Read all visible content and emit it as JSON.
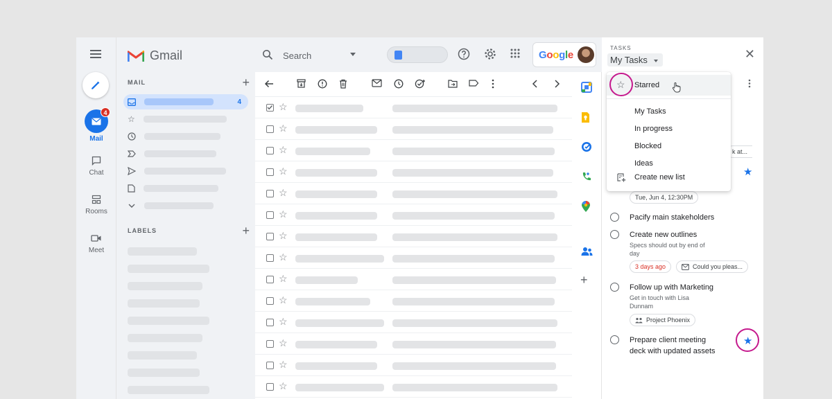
{
  "rail": {
    "items": [
      {
        "label": "Mail",
        "badge": "4"
      },
      {
        "label": "Chat"
      },
      {
        "label": "Rooms"
      },
      {
        "label": "Meet"
      }
    ]
  },
  "brand": {
    "name": "Gmail"
  },
  "sidebar": {
    "mail_section": "MAIL",
    "inbox_count": "4",
    "labels_section": "LABELS"
  },
  "search": {
    "placeholder": "Search"
  },
  "google_word": [
    "G",
    "o",
    "o",
    "g",
    "l",
    "e"
  ],
  "tasks": {
    "header": "TASKS",
    "list_name": "My Tasks",
    "items": [
      {
        "title": "Pacify main stakeholders"
      },
      {
        "title": "Create new outlines",
        "desc_line1": "Specs should out by end of",
        "desc_line2": "day",
        "chip_due": "3 days ago",
        "chip_email": "Could you pleas..."
      },
      {
        "title": "Follow up with Marketing",
        "desc_line1": "Get in touch with Lisa",
        "desc_line2": "Dunnam",
        "chip_room": "Project Phoenix"
      },
      {
        "title_line1": "Prepare client meeting",
        "title_line2": "deck with updated assets"
      }
    ],
    "date_chip": "Tue, Jun 4, 12:30PM",
    "partial_chip": "k at..."
  },
  "dropdown": {
    "starred": "Starred",
    "lists": [
      "My Tasks",
      "In progress",
      "Blocked",
      "Ideas"
    ],
    "create": "Create new list"
  },
  "colors": {
    "accent": "#1a73e8",
    "highlight_ring": "#c5198d",
    "badge": "#d93025"
  }
}
